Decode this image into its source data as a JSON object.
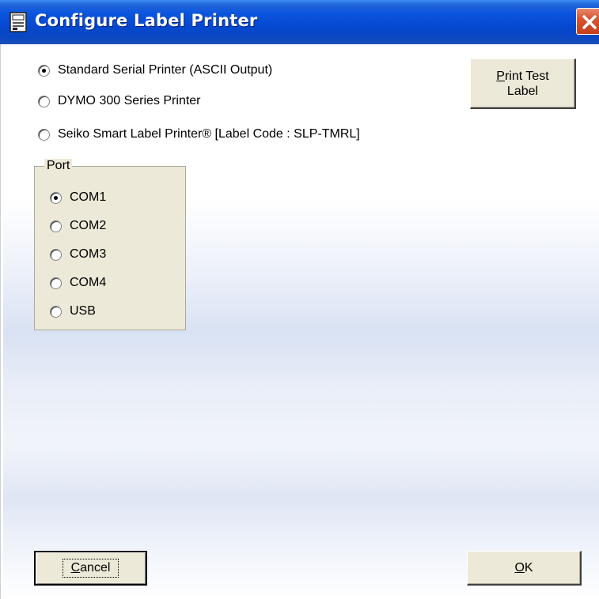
{
  "window": {
    "title": "Configure Label Printer",
    "close_icon": "close-icon",
    "app_icon": "printer-icon"
  },
  "printer_types": [
    {
      "label": "Standard Serial Printer (ASCII Output)",
      "checked": true
    },
    {
      "label": "DYMO 300 Series Printer",
      "checked": false
    },
    {
      "label": "Seiko Smart Label Printer® [Label Code : SLP-TMRL]",
      "checked": false
    }
  ],
  "print_test": {
    "line1": "Print Test",
    "line1_mnemonic": "P",
    "line1_rest": "rint Test",
    "line2": "Label"
  },
  "port": {
    "legend": "Port",
    "options": [
      {
        "label": "COM1",
        "checked": true
      },
      {
        "label": "COM2",
        "checked": false
      },
      {
        "label": "COM3",
        "checked": false
      },
      {
        "label": "COM4",
        "checked": false
      },
      {
        "label": "USB",
        "checked": false
      }
    ]
  },
  "buttons": {
    "cancel_mnemonic": "C",
    "cancel_rest": "ancel",
    "ok_mnemonic": "O",
    "ok_rest": "K"
  },
  "colors": {
    "title_bar": "#0548cf",
    "close_button": "#d9532f",
    "dialog_face": "#ece9d8"
  }
}
